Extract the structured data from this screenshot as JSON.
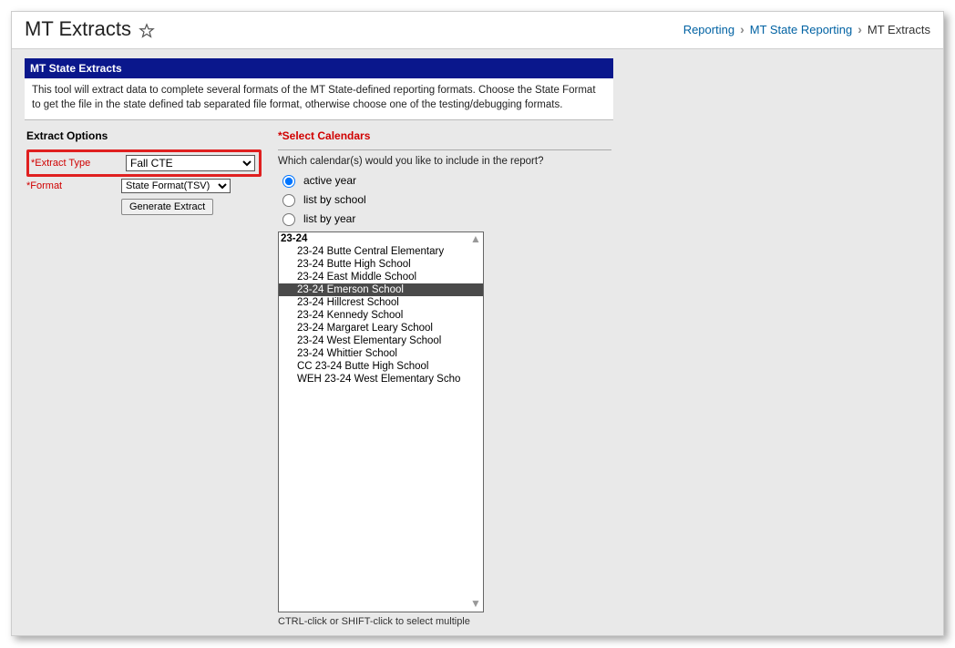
{
  "header": {
    "title": "MT Extracts",
    "breadcrumb": {
      "link1": "Reporting",
      "link2": "MT State Reporting",
      "current": "MT Extracts"
    }
  },
  "panel": {
    "title": "MT State Extracts",
    "description": "This tool will extract data to complete several formats of the MT State-defined reporting formats. Choose the State Format to get the file in the state defined tab separated file format, otherwise choose one of the testing/debugging formats."
  },
  "left": {
    "section_title": "Extract Options",
    "extract_type_label": "Extract Type",
    "extract_type_value": "Fall CTE",
    "format_label": "Format",
    "format_value": "State Format(TSV)",
    "generate_btn": "Generate Extract"
  },
  "right": {
    "section_title": "Select Calendars",
    "prompt": "Which calendar(s) would you like to include in the report?",
    "radio1": "active year",
    "radio2": "list by school",
    "radio3": "list by year",
    "group_label": "23-24",
    "items": [
      "23-24 Butte Central Elementary",
      "23-24 Butte High School",
      "23-24 East Middle School",
      "23-24 Emerson School",
      "23-24 Hillcrest School",
      "23-24 Kennedy School",
      "23-24 Margaret Leary School",
      "23-24 West Elementary School",
      "23-24 Whittier School",
      "CC 23-24 Butte High School",
      "WEH 23-24 West Elementary Scho"
    ],
    "selected_index": 3,
    "hint": "CTRL-click or SHIFT-click to select multiple"
  }
}
